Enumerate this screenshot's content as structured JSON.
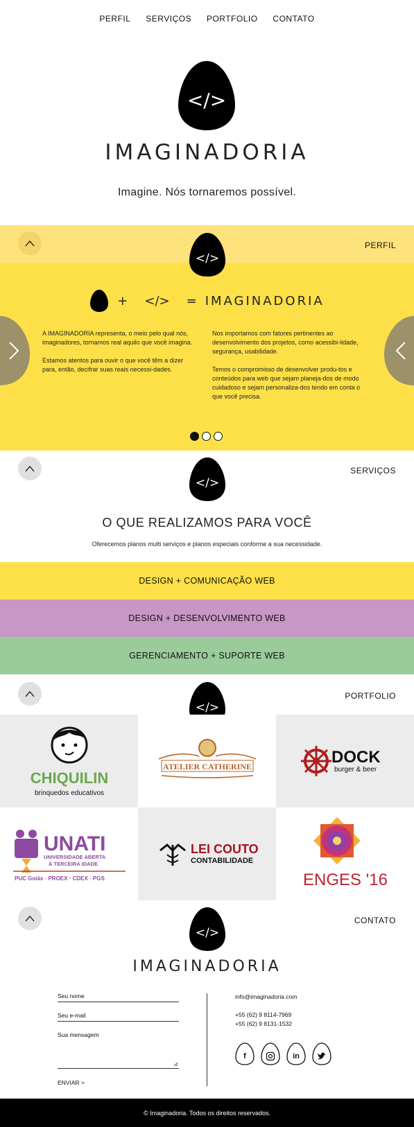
{
  "nav": {
    "items": [
      "PERFIL",
      "SERVIÇOS",
      "PORTFOLIO",
      "CONTATO"
    ]
  },
  "hero": {
    "logo_code": "</>",
    "brand": "IMAGINADORIA",
    "tagline": "Imagine. Nós tornaremos possível."
  },
  "perfil": {
    "label": "PERFIL",
    "equation": {
      "plus": "+",
      "code": "</>",
      "equals": "=",
      "result": "IMAGINADORIA"
    },
    "left_paragraphs": [
      "A IMAGINADORIA representa, o meio pelo qual nós, imaginadores, tornamos real aquilo que você imagina.",
      "Estamos atentos para ouvir o que você têm a dizer para, então, decifrar suas reais necessi-dades."
    ],
    "right_paragraphs": [
      "Nos importamos com fatores pertinentes ao desenvolvimento dos projetos, como acessibi-lidade, segurança, usabilidade.",
      "Temos o compromisso de desenvolver produ-tos e conteúdos para web que sejam planeja-dos de modo cuidadoso e sejam personaliza-dos tendo em conta o que você precisa."
    ],
    "prev_arrow": ">",
    "next_arrow": "<"
  },
  "servicos": {
    "label": "SERVIÇOS",
    "title": "O QUE REALIZAMOS PARA VOCÊ",
    "subtitle": "Oferecemos planos multi serviços e planos especiais conforme a sua necessidade.",
    "services": [
      {
        "label": "DESIGN + COMUNICAÇÃO WEB",
        "color": "#fde047"
      },
      {
        "label": "DESIGN + DESENVOLVIMENTO WEB",
        "color": "#c897c6"
      },
      {
        "label": "GERENCIAMENTO + SUPORTE WEB",
        "color": "#9acb9b"
      }
    ]
  },
  "portfolio": {
    "label": "PORTFOLIO",
    "clients": {
      "chiquilin": {
        "name": "CHIQUILIN",
        "tag": "brinquedos educativos"
      },
      "atelier": {
        "name": "ATELIER CATHERINE"
      },
      "dock": {
        "name": "DOCK",
        "tag": "burger & beer"
      },
      "unati": {
        "name": "UNATI",
        "line1": "UNIVERSIDADE ABERTA",
        "line2": "À TERCEIRA IDADE",
        "footer": "PUC Goiás · PROEX · CDEX · PGS"
      },
      "leicouto": {
        "name": "LEI COUTO",
        "tag": "CONTABILIDADE"
      },
      "enges": {
        "name": "ENGES '16"
      }
    },
    "tile_colors": [
      "#ececec",
      "#ffffff",
      "#ececec",
      "#ffffff",
      "#ececec",
      "#ffffff"
    ]
  },
  "contato": {
    "label": "CONTATO",
    "brand": "IMAGINADORIA",
    "fields": {
      "name": "Seu nome",
      "email": "Seu e-mail",
      "message": "Sua mensagem"
    },
    "send": "ENVIAR  >",
    "email": "info@imaginadoria.com",
    "phone1": "+55 (62) 9 8114-7969",
    "phone2": "+55 (62) 9 8131-1532",
    "social": [
      "f",
      "instagram",
      "in",
      "twitter"
    ]
  },
  "footer": {
    "text": "© Imaginadoria. Todos os direitos reservados."
  },
  "colors": {
    "yellow": "#fde047",
    "light_yellow": "#fee27c",
    "purple": "#c897c6",
    "green": "#9acb9b",
    "black": "#000000"
  }
}
